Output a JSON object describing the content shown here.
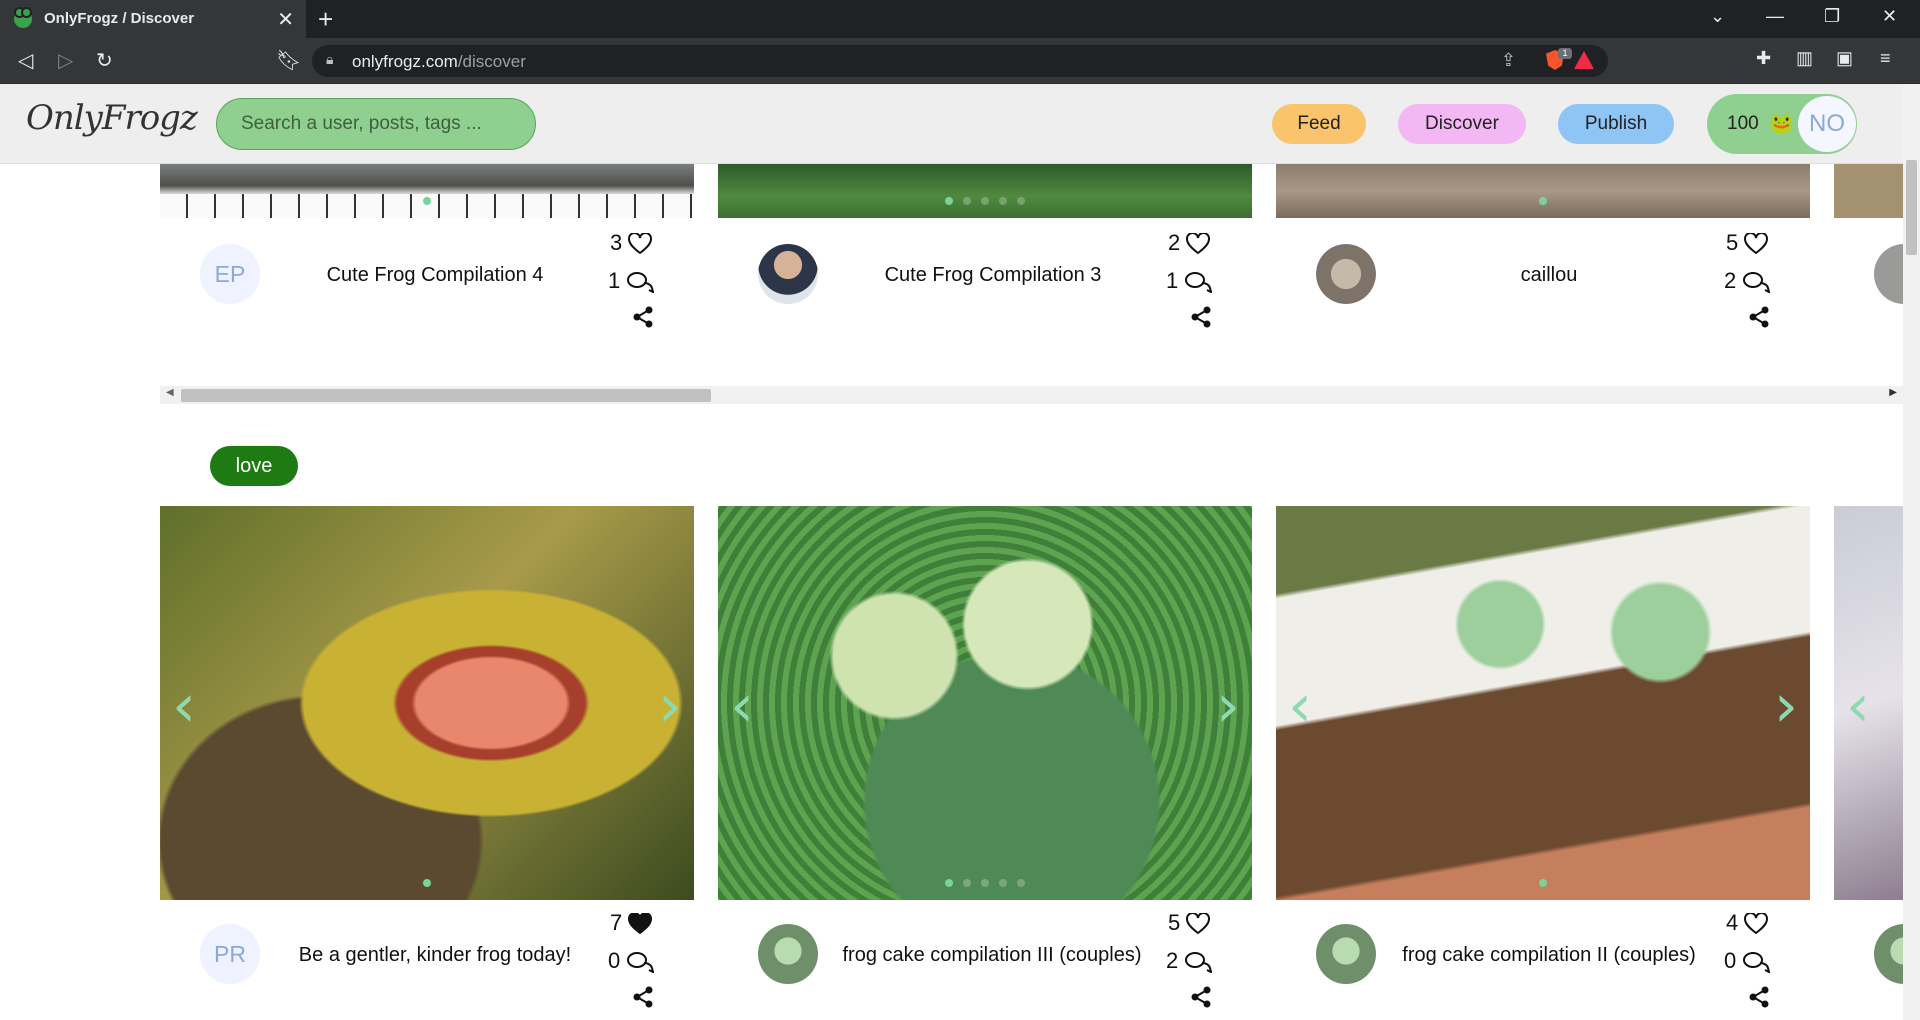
{
  "browser": {
    "tab_title": "OnlyFrogz / Discover",
    "url_domain": "onlyfrogz.com",
    "url_path": "/discover",
    "shield_count": "1"
  },
  "site": {
    "logo": "OnlyFrogz",
    "search_placeholder": "Search a user, posts, tags ...",
    "nav": {
      "feed": "Feed",
      "discover": "Discover",
      "publish": "Publish"
    },
    "balance": "100",
    "balance_icon": "🐸",
    "user_initials": "NO"
  },
  "rows": [
    {
      "tag": "",
      "cards": [
        {
          "title": "Cute Frog Compilation 4",
          "avatar_initials": "EP",
          "likes": "3",
          "comments": "1",
          "liked": false
        },
        {
          "title": "Cute Frog Compilation 3",
          "avatar_initials": "",
          "likes": "2",
          "comments": "1",
          "liked": false
        },
        {
          "title": "caillou",
          "avatar_initials": "",
          "likes": "5",
          "comments": "2",
          "liked": false
        }
      ]
    },
    {
      "tag": "love",
      "cards": [
        {
          "title": "Be a gentler, kinder frog today!",
          "avatar_initials": "PR",
          "likes": "7",
          "comments": "0",
          "liked": true
        },
        {
          "title": "frog cake compilation III (couples)",
          "avatar_initials": "",
          "likes": "5",
          "comments": "2",
          "liked": false
        },
        {
          "title": "frog cake compilation II (couples)",
          "avatar_initials": "",
          "likes": "4",
          "comments": "0",
          "liked": false
        }
      ]
    }
  ],
  "colors": {
    "search_bg": "#8fcf8f",
    "feed": "#f9c46c",
    "discover": "#f3b7f3",
    "publish": "#8ec5f5",
    "tag": "#1e7a13",
    "carousel_dot": "#7bd39b"
  }
}
